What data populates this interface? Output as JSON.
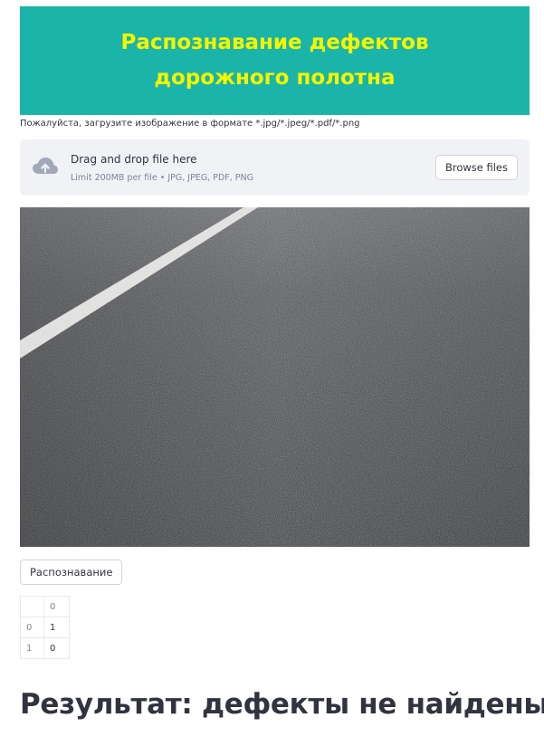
{
  "banner": {
    "title": "Распознавание дефектов дорожного полотна",
    "background_color": "#1ab5a8",
    "text_color": "#f5f500"
  },
  "upload": {
    "hint": "Пожалуйста, загрузите изображение в формате *.jpg/*.jpeg/*.pdf/*.png",
    "dropzone_title": "Drag and drop file here",
    "dropzone_limit": "Limit 200MB per file • JPG, JPEG, PDF, PNG",
    "browse_label": "Browse files",
    "icon": "cloud-upload-icon"
  },
  "image": {
    "subject": "asphalt road surface with white lane marking"
  },
  "recognize_button": "Распознавание",
  "dataframe": {
    "columns": [
      "0"
    ],
    "rows": [
      {
        "index": "0",
        "values": [
          "1"
        ]
      },
      {
        "index": "1",
        "values": [
          "0"
        ]
      }
    ]
  },
  "result": "Результат: дефекты не найдены!"
}
